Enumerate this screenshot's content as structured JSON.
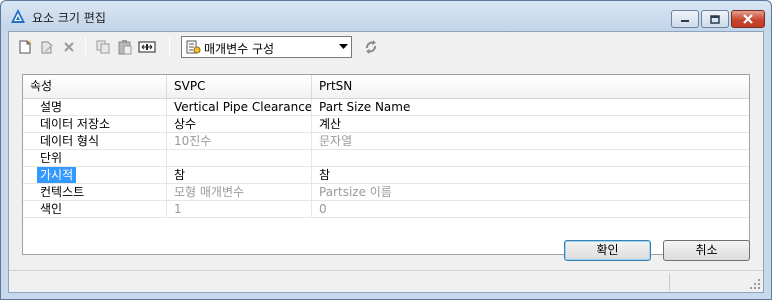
{
  "window": {
    "title": "요소 크기 편집"
  },
  "toolbar": {
    "config_combo_value": "매개변수 구성"
  },
  "grid": {
    "headers": [
      "속성",
      "SVPC",
      "PrtSN"
    ],
    "rows": [
      {
        "label": "설명",
        "svpc": "Vertical Pipe Clearance",
        "prtsn": "Part Size Name",
        "disabled": false
      },
      {
        "label": "데이터 저장소",
        "svpc": "상수",
        "prtsn": "계산",
        "disabled": false
      },
      {
        "label": "데이터 형식",
        "svpc": "10진수",
        "prtsn": "문자열",
        "disabled": true
      },
      {
        "label": "단위",
        "svpc": "",
        "prtsn": "",
        "disabled": false
      },
      {
        "label": "가시적",
        "svpc": "참",
        "prtsn": "참",
        "disabled": false
      },
      {
        "label": "컨텍스트",
        "svpc": "모형 매개변수",
        "prtsn": "Partsize 이름",
        "disabled": true
      },
      {
        "label": "색인",
        "svpc": "1",
        "prtsn": "0",
        "disabled": true
      }
    ]
  },
  "buttons": {
    "ok": "확인",
    "cancel": "취소"
  },
  "colors": {
    "selection": "#3399ff",
    "close_button": "#c8452d",
    "title_bar": "#c2d5ea"
  }
}
